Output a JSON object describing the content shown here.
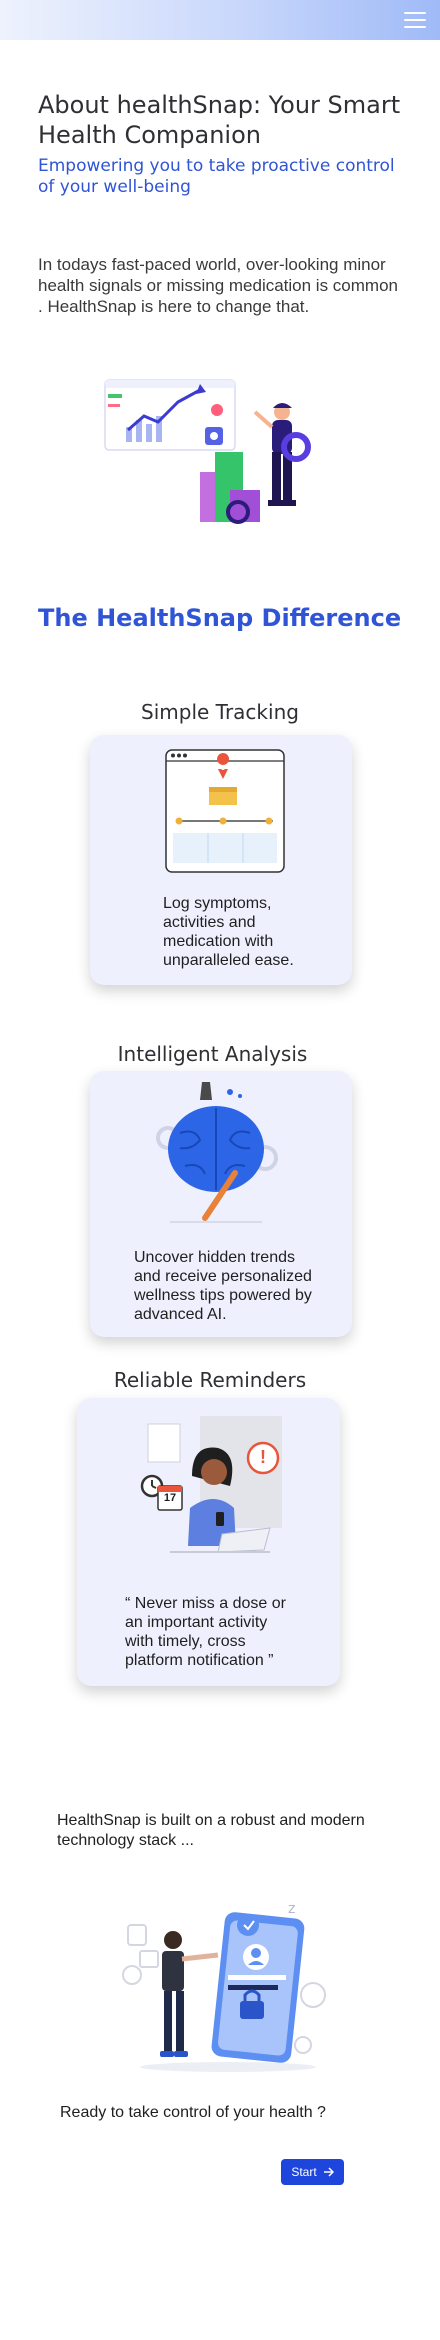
{
  "header": {
    "menu_icon": "hamburger-menu-icon"
  },
  "hero": {
    "title": "About healthSnap: Your Smart Health Companion",
    "subtitle": "Empowering you to take proactive control of your well-being",
    "intro": "In todays fast-paced world, over-looking minor health signals or missing medication is common . HealthSnap is here to change that."
  },
  "difference": {
    "title": "The HealthSnap Difference",
    "features": [
      {
        "title": "Simple Tracking",
        "text": "Log symptoms, activities and medication with unparalleled ease."
      },
      {
        "title": "Intelligent  Analysis",
        "text": "Uncover hidden trends and receive personalized wellness tips powered by advanced AI."
      },
      {
        "title": "Reliable Reminders",
        "text": "“ Never miss a dose or an important activity with timely, cross platform notification ”",
        "calendar_day": "17",
        "alert": "!"
      }
    ]
  },
  "tech": {
    "text": "HealthSnap is built on a robust and modern technology stack ..."
  },
  "cta": {
    "text": "Ready to take control of your health ?",
    "button_label": "Start",
    "button_icon": "arrow-right-icon"
  },
  "colors": {
    "accent": "#2f54d6",
    "button": "#1f46dc",
    "card_bg": "#eef0fd"
  }
}
